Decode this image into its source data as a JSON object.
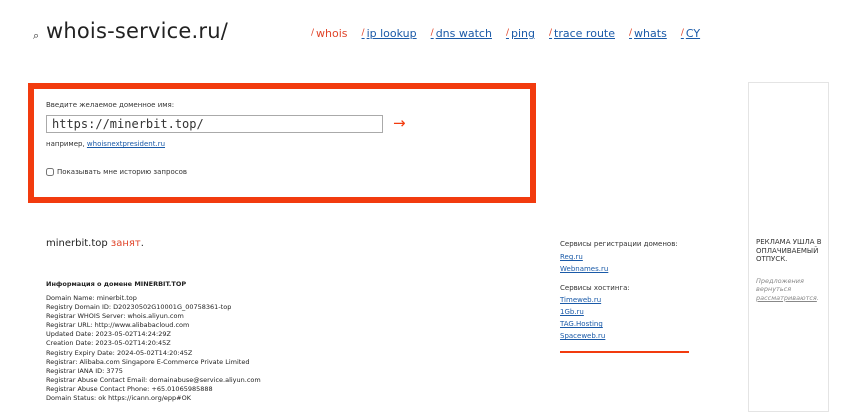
{
  "header": {
    "logo_key": "⌕",
    "logo": "whois-service.ru/",
    "nav": [
      {
        "label": "whois",
        "active": true
      },
      {
        "label": "ip lookup",
        "active": false
      },
      {
        "label": "dns watch",
        "active": false
      },
      {
        "label": "ping",
        "active": false
      },
      {
        "label": "trace route",
        "active": false
      },
      {
        "label": "whats",
        "active": false
      },
      {
        "label": "CY",
        "active": false
      }
    ]
  },
  "search": {
    "label": "Введите желаемое доменное имя:",
    "value": "https://minerbit.top/",
    "submit_arrow": "→",
    "example_prefix": "например, ",
    "example_link": "whoisnextpresident.ru",
    "history_label": "Показывать мне историю запросов",
    "history_checked": false
  },
  "result": {
    "domain": "minerbit.top",
    "status": "занят",
    "status_suffix": ".",
    "info_title": "Информация о домене MINERBIT.TOP",
    "lines": [
      "Domain Name: minerbit.top",
      "Registry Domain ID: D20230502G10001G_00758361-top",
      "Registrar WHOIS Server: whois.aliyun.com",
      "Registrar URL: http://www.alibabacloud.com",
      "Updated Date: 2023-05-02T14:24:29Z",
      "Creation Date: 2023-05-02T14:20:45Z",
      "Registry Expiry Date: 2024-05-02T14:20:45Z",
      "Registrar: Alibaba.com Singapore E-Commerce Private Limited",
      "Registrar IANA ID: 3775",
      "Registrar Abuse Contact Email: domainabuse@service.aliyun.com",
      "Registrar Abuse Contact Phone: +65.01065985888",
      "Domain Status: ok https://icann.org/epp#OK"
    ]
  },
  "services": {
    "registration_head": "Сервисы регистрации доменов:",
    "registration": [
      "Reg.ru",
      "Webnames.ru"
    ],
    "hosting_head": "Сервисы хостинга:",
    "hosting": [
      "Timeweb.ru",
      "1Gb.ru",
      "TAG.Hosting",
      "Spaceweb.ru"
    ]
  },
  "ad": {
    "title": "РЕКЛАМА УШЛА В ОПЛАЧИВАЕМЫЙ ОТПУСК.",
    "note_prefix": "Предложения вернуться ",
    "note_link": "рассматриваются",
    "note_suffix": "."
  },
  "colors": {
    "accent": "#f23b0e",
    "link": "#1a5aa8"
  }
}
